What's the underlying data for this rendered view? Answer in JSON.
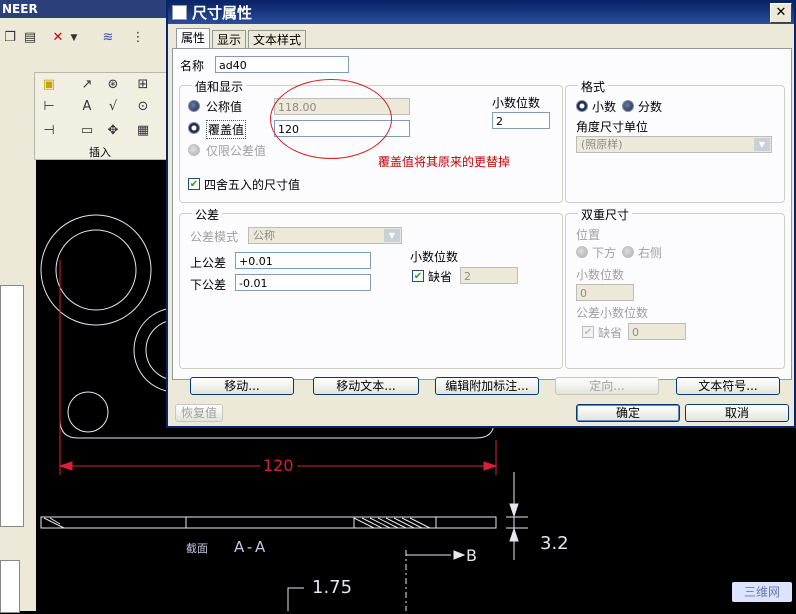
{
  "background": {
    "app_title": "NEER",
    "ribbon_group_label": "插入",
    "drawing": {
      "dimension_main": "120",
      "dimension_side": "3.2",
      "dimension_bottom": "1.75",
      "section_label_prefix": "截面",
      "section_label": "A-A",
      "arrow_label": "B",
      "colors": {
        "dimension": "#d81f3c",
        "geometry": "#e6e6f0",
        "annotation": "#c8c8e8"
      }
    },
    "watermark": "三维网"
  },
  "dialog": {
    "title": "尺寸属性",
    "close_label": "✕",
    "tabs": [
      {
        "label": "属性",
        "active": true
      },
      {
        "label": "显示",
        "active": false
      },
      {
        "label": "文本样式",
        "active": false
      }
    ],
    "name_label": "名称",
    "name_value": "ad40",
    "value_display": {
      "title": "值和显示",
      "nominal_label": "公称值",
      "nominal_value": "118.00",
      "override_label": "覆盖值",
      "override_value": "120",
      "tolerance_only_label": "仅限公差值",
      "decimal_places_label": "小数位数",
      "decimal_places_value": "2",
      "rounded_label": "四舍五入的尺寸值",
      "rounded_checked": true
    },
    "annotation_text": "覆盖值将其原来的更替掉",
    "format": {
      "title": "格式",
      "decimal_label": "小数",
      "fraction_label": "分数",
      "angle_unit_label": "角度尺寸单位",
      "angle_unit_value": "(照原样)"
    },
    "tolerance": {
      "title": "公差",
      "mode_label": "公差模式",
      "mode_value": "公称",
      "upper_label": "上公差",
      "upper_value": "+0.01",
      "lower_label": "下公差",
      "lower_value": "-0.01",
      "decimal_places_label": "小数位数",
      "default_label": "缺省",
      "default_value": "2"
    },
    "dual": {
      "title": "双重尺寸",
      "position_label": "位置",
      "below_label": "下方",
      "right_label": "右侧",
      "decimal_places_label": "小数位数",
      "decimal_places_value": "0",
      "tol_decimal_label": "公差小数位数",
      "default_label": "缺省",
      "default_value": "0"
    },
    "buttons": {
      "move": "移动...",
      "move_text": "移动文本...",
      "edit_attach": "编辑附加标注...",
      "orient": "定向...",
      "text_symbol": "文本符号...",
      "restore": "恢复值",
      "ok": "确定",
      "cancel": "取消"
    }
  }
}
